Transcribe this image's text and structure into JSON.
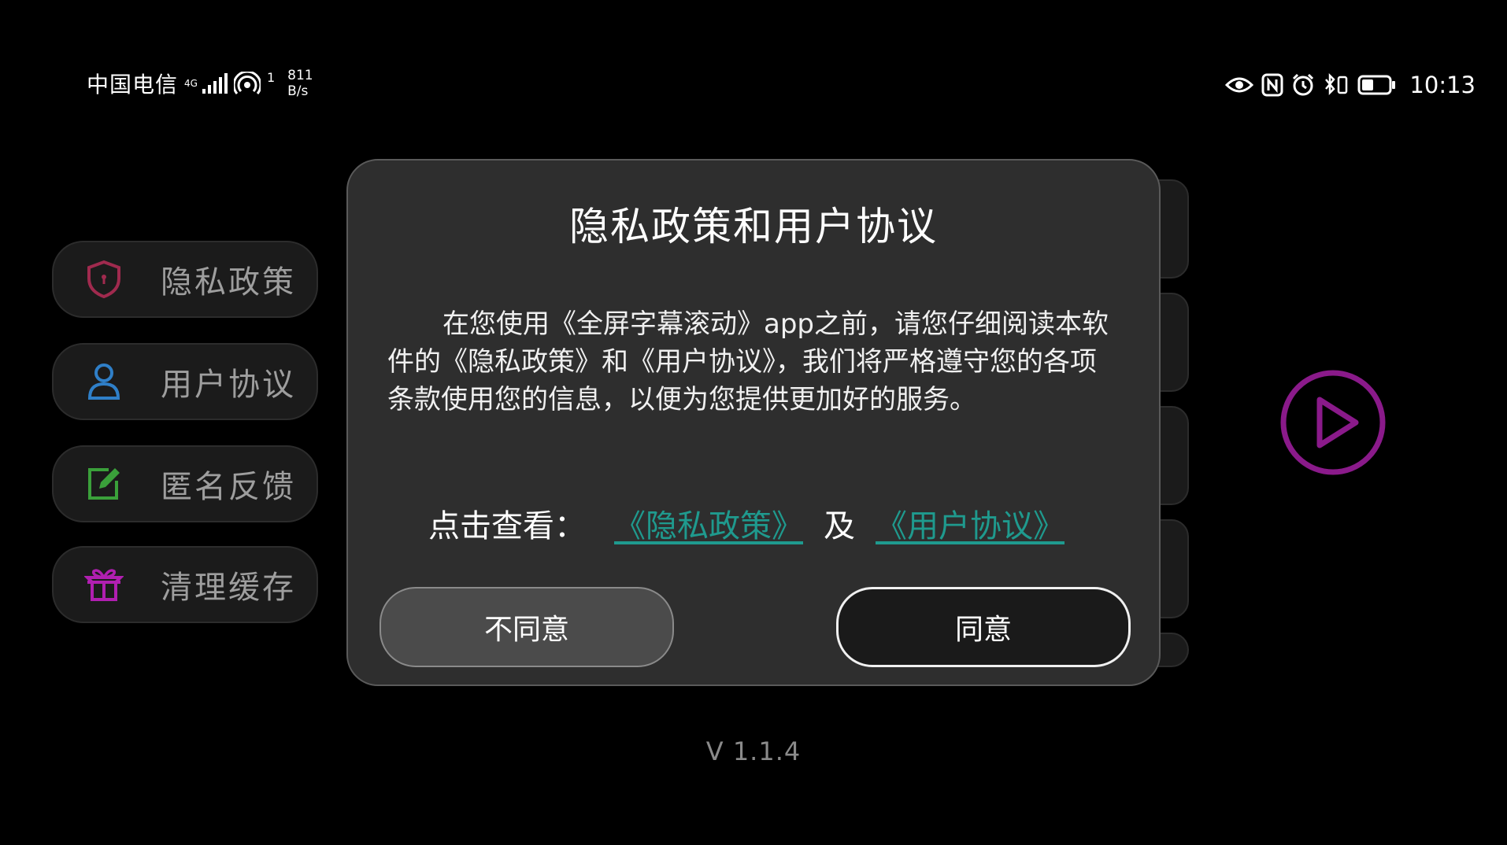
{
  "status_bar": {
    "carrier": "中国电信",
    "network_type": "4G",
    "hotspot_count": "1",
    "speed_value": "811",
    "speed_unit": "B/s",
    "time": "10:13"
  },
  "menu": [
    {
      "label": "隐私政策",
      "icon": "shield-icon",
      "color": "#a02a4e"
    },
    {
      "label": "用户协议",
      "icon": "user-icon",
      "color": "#2f7fc8"
    },
    {
      "label": "匿名反馈",
      "icon": "edit-icon",
      "color": "#3aa03a"
    },
    {
      "label": "清理缓存",
      "icon": "trash-icon",
      "color": "#b01fb0"
    }
  ],
  "dialog": {
    "title": "隐私政策和用户协议",
    "body": "在您使用《全屏字幕滚动》app之前，请您仔细阅读本软件的《隐私政策》和《用户协议》，我们将严格遵守您的各项条款使用您的信息，以便为您提供更加好的服务。",
    "links_label": "点击查看：",
    "privacy_link": "《隐私政策》",
    "and_text": "及",
    "agreement_link": "《用户协议》",
    "disagree_label": "不同意",
    "agree_label": "同意"
  },
  "version": "V 1.1.4",
  "colors": {
    "link": "#1f9a8e",
    "play_accent": "#8a1a8a"
  }
}
